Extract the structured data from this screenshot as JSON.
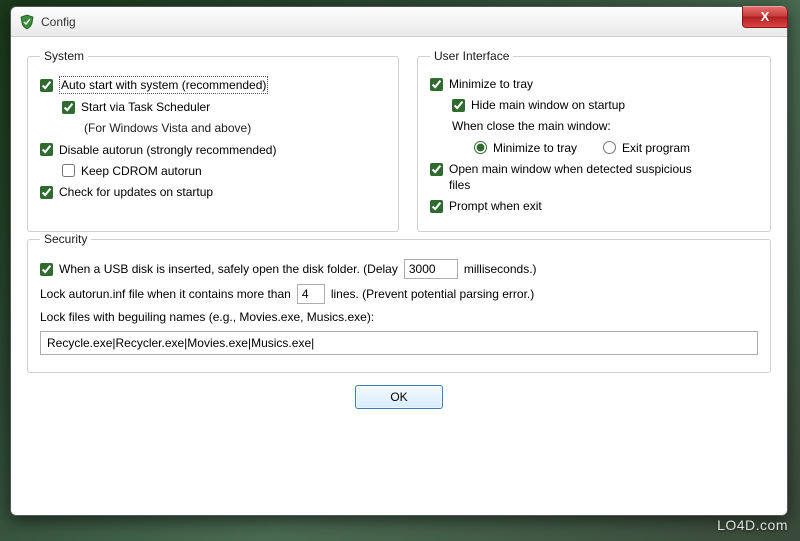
{
  "window": {
    "title": "Config",
    "close_label": "X"
  },
  "groups": {
    "system_legend": "System",
    "ui_legend": "User Interface",
    "security_legend": "Security"
  },
  "system": {
    "auto_start": "Auto start with system (recommended)",
    "start_via_scheduler": "Start via Task Scheduler",
    "scheduler_note": "(For Windows Vista and above)",
    "disable_autorun": "Disable autorun (strongly recommended)",
    "keep_cdrom": "Keep CDROM autorun",
    "check_updates": "Check for updates on startup"
  },
  "ui": {
    "minimize_tray": "Minimize to tray",
    "hide_main_on_startup": "Hide main window on startup",
    "when_close_label": "When close the main window:",
    "radio_minimize": "Minimize to tray",
    "radio_exit": "Exit program",
    "open_on_detect": "Open main window when detected suspicious files",
    "prompt_exit": "Prompt when exit"
  },
  "security": {
    "usb_open_prefix": "When a USB disk is inserted, safely open the disk folder. (Delay",
    "usb_open_suffix": "milliseconds.)",
    "delay_value": "3000",
    "lock_autorun_prefix": "Lock autorun.inf file when it contains more than",
    "lock_autorun_suffix": "lines. (Prevent potential parsing error.)",
    "lines_value": "4",
    "lock_files_label": "Lock files with beguiling names (e.g., Movies.exe, Musics.exe):",
    "lock_files_value": "Recycle.exe|Recycler.exe|Movies.exe|Musics.exe|"
  },
  "buttons": {
    "ok": "OK"
  },
  "watermark": "LO4D.com"
}
